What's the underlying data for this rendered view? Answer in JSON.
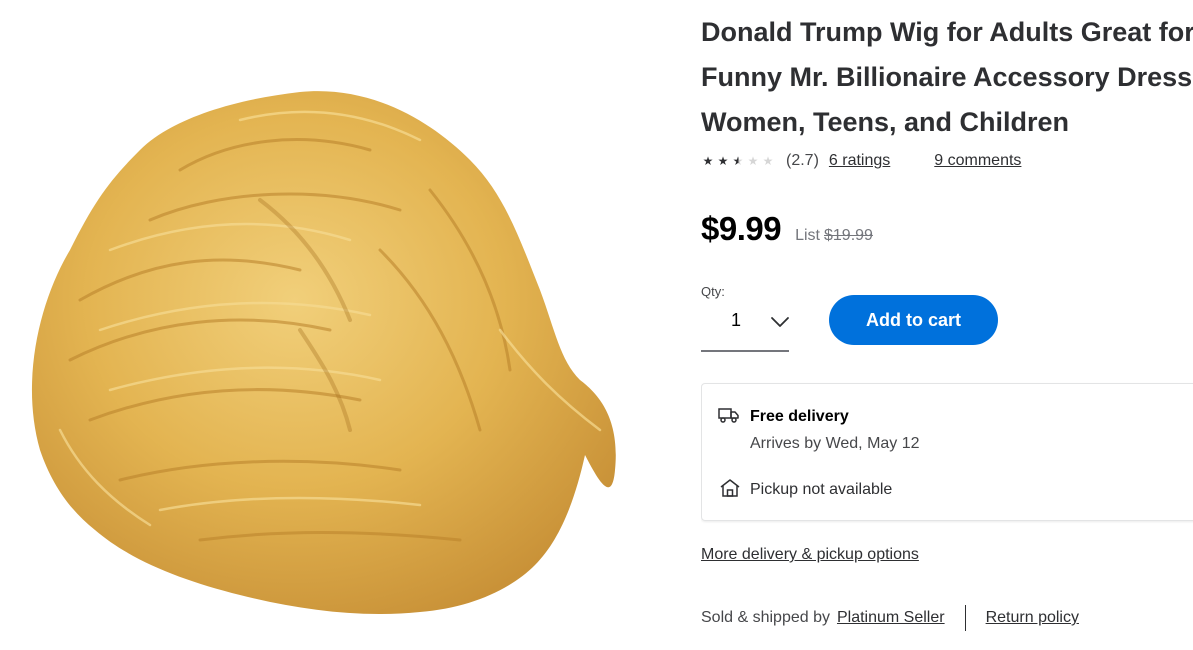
{
  "product": {
    "image_alt": "Blonde wig",
    "title_lines": [
      "Donald Trump Wig for Adults Great for",
      "Funny Mr. Billionaire Accessory Dress Up",
      "Women, Teens, and Children"
    ],
    "rating": {
      "value": 2.7,
      "value_text": "(2.7)",
      "ratings_link": "6 ratings",
      "comments_link": "9 comments"
    },
    "price": {
      "current": "$9.99",
      "list_label": "List",
      "list_price": "$19.99"
    },
    "quantity": {
      "label": "Qty:",
      "value": "1"
    },
    "add_to_cart_label": "Add to cart",
    "fulfillment": {
      "delivery_title": "Free delivery",
      "delivery_arrival": "Arrives by Wed, May 12",
      "pickup_text": "Pickup not available"
    },
    "more_options_link": "More delivery & pickup options",
    "seller": {
      "sold_by_label": "Sold & shipped by",
      "seller_name": "Platinum Seller",
      "return_policy_link": "Return policy"
    }
  },
  "icons": {
    "star_full": "star-full-icon",
    "star_half": "star-half-icon",
    "star_empty": "star-empty-icon",
    "chevron": "chevron-down-icon",
    "truck": "truck-icon",
    "store": "store-icon"
  },
  "colors": {
    "accent": "#0071dc",
    "text": "#2e2f32",
    "muted": "#74767c",
    "hair_base": "#e3b451",
    "hair_shadow": "#b9812a",
    "hair_light": "#f4d37e"
  }
}
